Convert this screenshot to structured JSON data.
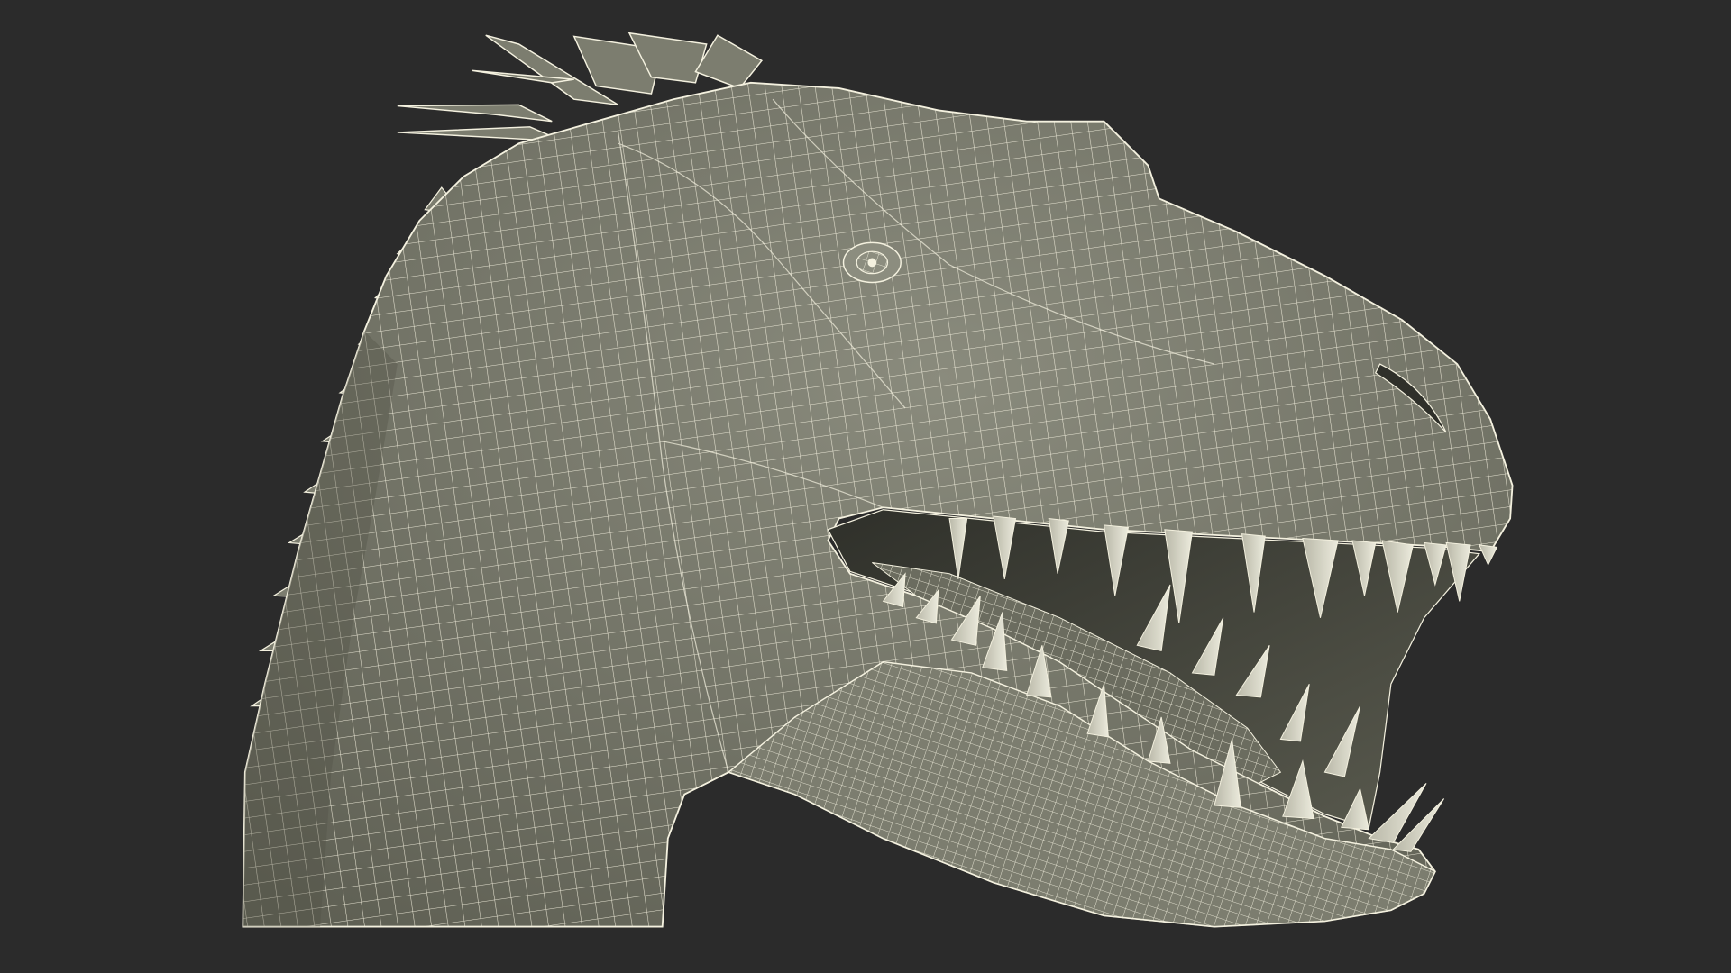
{
  "scene": {
    "subject_icon": "dinosaur-head-wireframe-icon",
    "background_color": "#2b2b2b",
    "surface_color": "#7c7d6f",
    "surface_shadow_color": "#555649",
    "mouth_interior_color": "#3a3b33",
    "wire_color": "#f4f1df",
    "tooth_color": "#d9d8c8"
  }
}
